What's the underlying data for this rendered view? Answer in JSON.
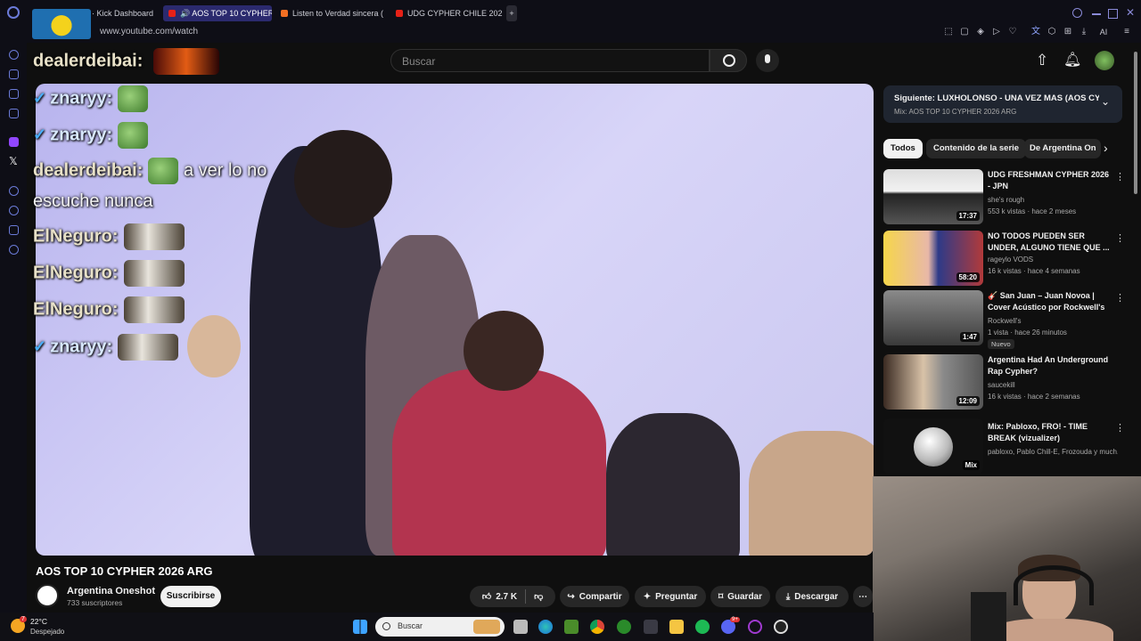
{
  "browser": {
    "tabs": [
      {
        "label": "· Kick Dashboard"
      },
      {
        "label": "🔊 AOS TOP 10 CYPHER 2",
        "active": true
      },
      {
        "label": "Listen to Verdad sincera (V"
      },
      {
        "label": "UDG CYPHER CHILE 2026"
      }
    ],
    "new_tab": "+",
    "url": "www.youtube.com/watch",
    "ai_label": "AI"
  },
  "youtube": {
    "search_placeholder": "Buscar",
    "video_title": "AOS TOP 10 CYPHER 2026 ARG",
    "channel": {
      "name": "Argentina Oneshot",
      "subs": "733 suscriptores",
      "subscribe": "Suscribirse"
    },
    "actions": {
      "likes": "2.7 K",
      "share": "Compartir",
      "ask": "Preguntar",
      "save": "Guardar",
      "download": "Descargar",
      "more": "⋯"
    },
    "next": {
      "title": "Siguiente: LUXHOLONSO - UNA VEZ MAS (AOS CY...",
      "sub": "Mix: AOS TOP 10 CYPHER 2026 ARG"
    },
    "chips": [
      "Todos",
      "Contenido de la serie",
      "De Argentina On"
    ],
    "videos": [
      {
        "title": "UDG FRESHMAN CYPHER 2026 - JPN",
        "channel": "she's rough",
        "meta": "553 k vistas · hace 2 meses",
        "duration": "17:37"
      },
      {
        "title": "NO TODOS PUEDEN SER UNDER, ALGUNO TIENE QUE ...",
        "channel": "rageylo VODS",
        "meta": "16 k vistas · hace 4 semanas",
        "duration": "58:20"
      },
      {
        "title": "🎸 San Juan – Juan Novoa | Cover Acústico por Rockwell's",
        "channel": "Rockwell's",
        "meta": "1 vista · hace 26 minutos",
        "duration": "1:47",
        "badge": "Nuevo"
      },
      {
        "title": "Argentina Had An Underground Rap Cypher?",
        "channel": "saucekill",
        "meta": "16 k vistas · hace 2 semanas",
        "duration": "12:09"
      },
      {
        "title": "Mix: Pabloxo, FRO! - TIME BREAK (vizualizer)",
        "channel": "pabloxo, Pablo Chill-E, Frozouda y much...",
        "meta": "",
        "duration": "Mix"
      }
    ]
  },
  "chat_overlay": [
    {
      "user": "dealerdeibai:",
      "text": ""
    },
    {
      "user": "znaryy:",
      "text": ""
    },
    {
      "user": "znaryy:",
      "text": ""
    },
    {
      "user": "dealerdeibai:",
      "text": "a ver lo no"
    },
    {
      "user": "",
      "text": "escuche nunca"
    },
    {
      "user": "ElNeguro:",
      "text": ""
    },
    {
      "user": "ElNeguro:",
      "text": ""
    },
    {
      "user": "ElNeguro:",
      "text": ""
    },
    {
      "user": "znaryy:",
      "text": ""
    }
  ],
  "taskbar": {
    "temp": "22°C",
    "weather": "Despejado",
    "search": "Buscar",
    "notif_count": "7",
    "discord_badge": "9+"
  }
}
